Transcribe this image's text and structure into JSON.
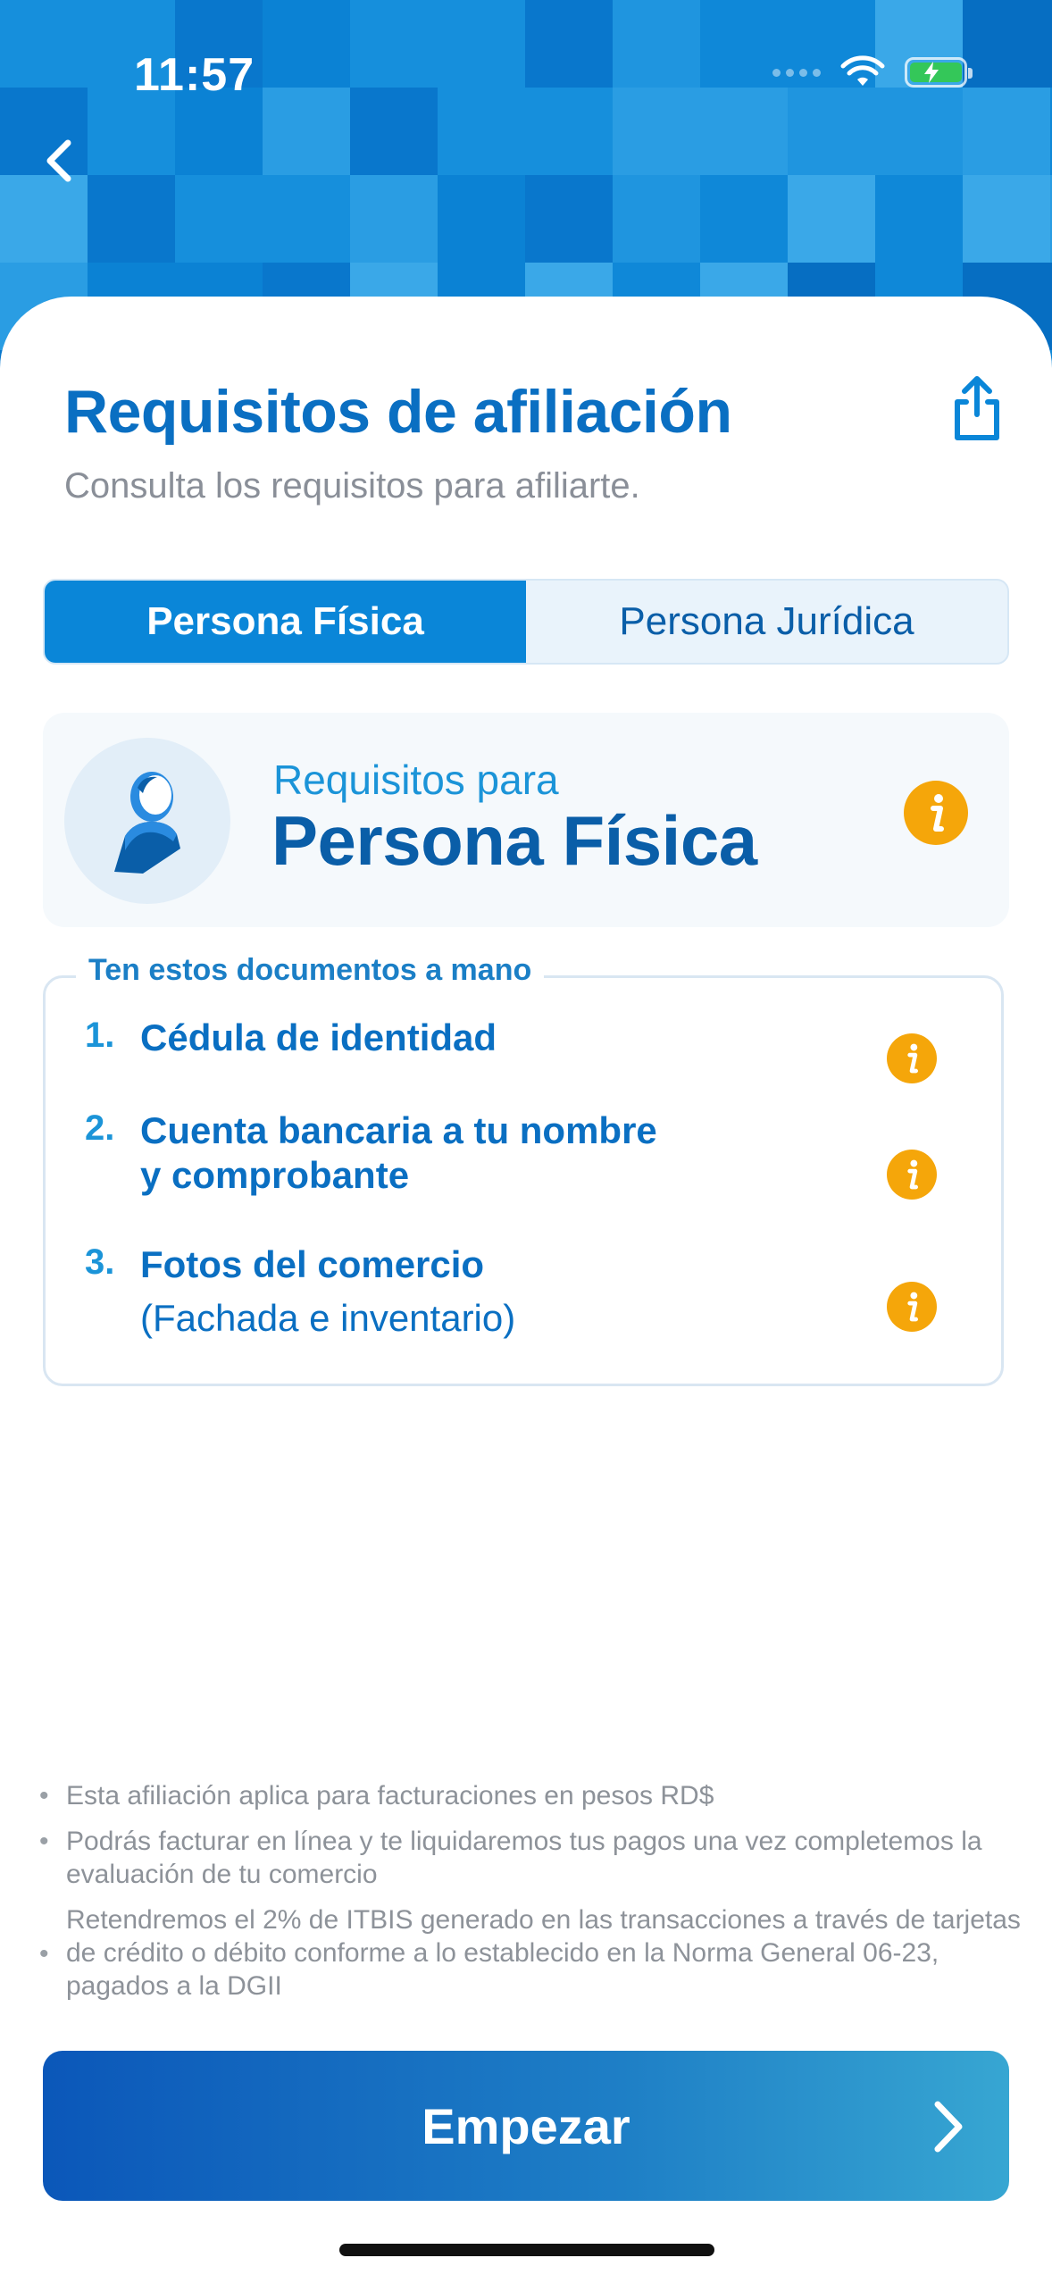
{
  "status_bar": {
    "time": "11:57"
  },
  "header": {
    "back_icon": "chevron-left-icon"
  },
  "page": {
    "title": "Requisitos de afiliación",
    "subtitle": "Consulta los requisitos para afiliarte.",
    "share_icon": "share-icon"
  },
  "tabs": [
    {
      "label": "Persona Física",
      "active": true
    },
    {
      "label": "Persona Jurídica",
      "active": false
    }
  ],
  "requirements_panel": {
    "label": "Requisitos para",
    "title": "Persona Física",
    "icon": "person-icon"
  },
  "documents": {
    "legend": "Ten estos documentos a mano",
    "items": [
      {
        "number": "1.",
        "line1": "Cédula de identidad",
        "line2": ""
      },
      {
        "number": "2.",
        "line1": "Cuenta bancaria a tu nombre",
        "line2": "y comprobante"
      },
      {
        "number": "3.",
        "line1": "Fotos del comercio",
        "line2": "(Fachada e inventario)"
      }
    ]
  },
  "notes": [
    "Esta afiliación aplica para facturaciones en pesos RD$",
    "Podrás facturar en línea y te liquidaremos tus pagos una vez completemos la evaluación de tu comercio",
    "Retendremos el 2% de ITBIS generado en las transacciones a través de tarjetas de crédito o débito conforme a lo establecido en la Norma General 06-23, pagados a la DGII"
  ],
  "cta": {
    "label": "Empezar"
  },
  "colors": {
    "primary": "#0a86d8",
    "title": "#0a6fc2",
    "info": "#f5a60a"
  }
}
